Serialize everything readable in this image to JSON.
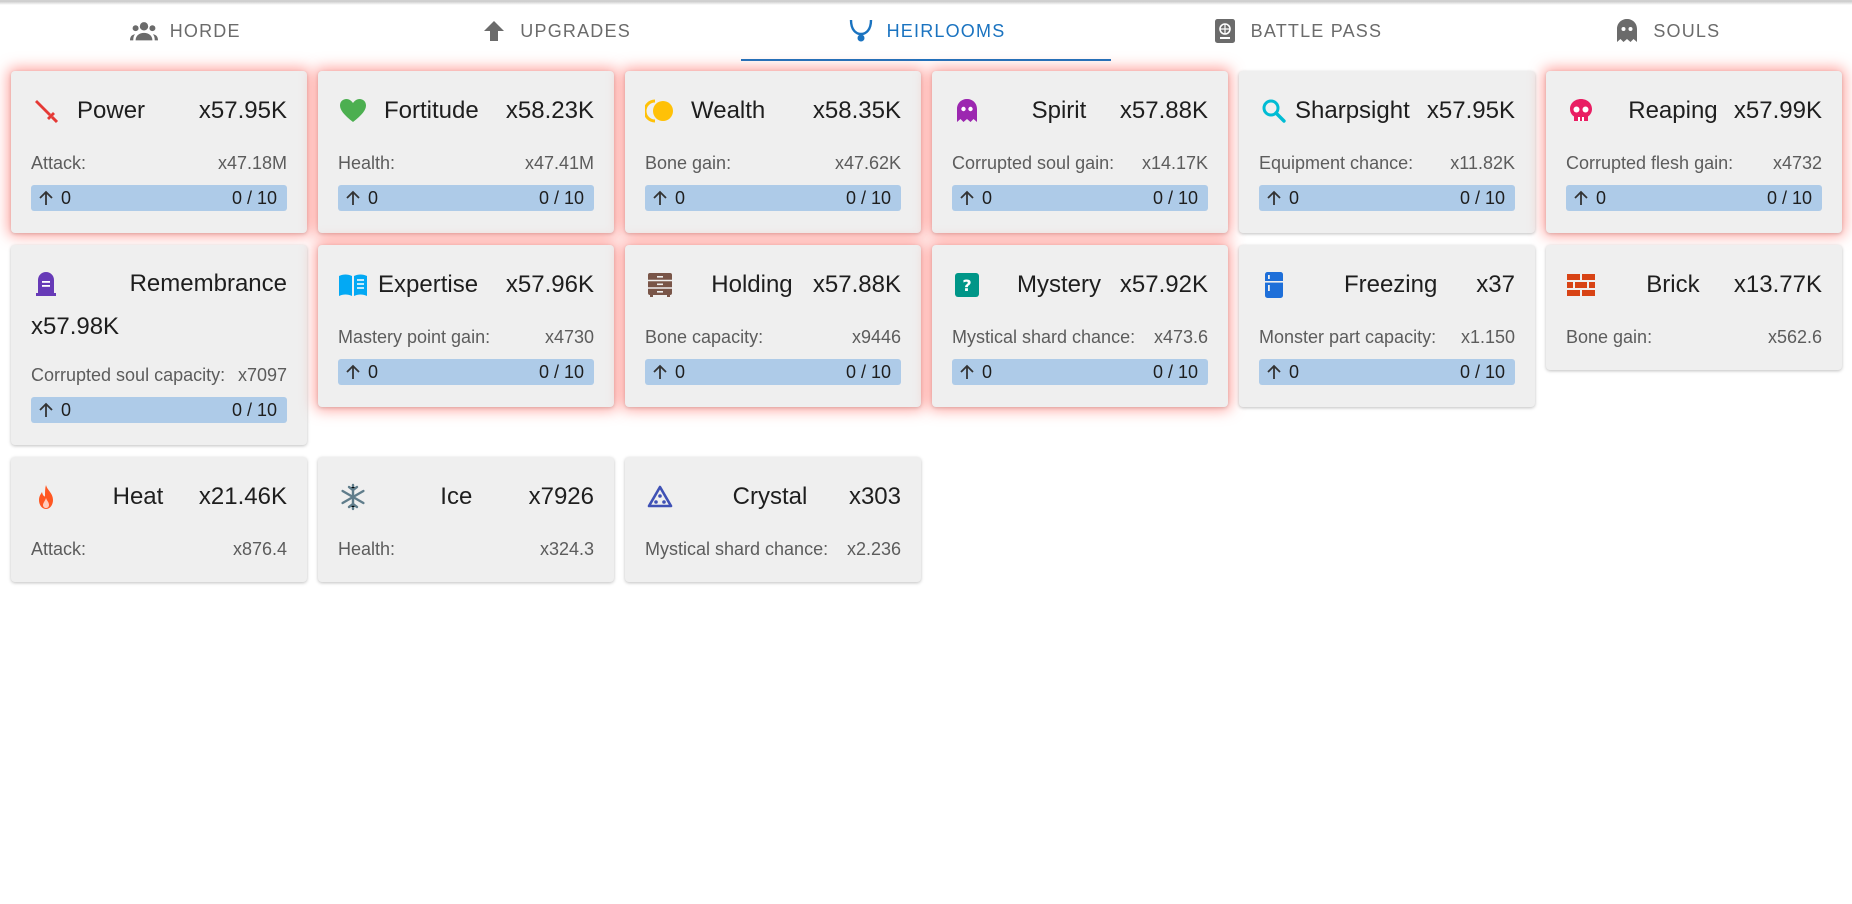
{
  "tabs": [
    {
      "label": "HORDE",
      "icon": "group-icon"
    },
    {
      "label": "UPGRADES",
      "icon": "arrow-up-icon"
    },
    {
      "label": "HEIRLOOMS",
      "icon": "necklace-icon",
      "active": true
    },
    {
      "label": "BATTLE PASS",
      "icon": "passport-icon"
    },
    {
      "label": "SOULS",
      "icon": "ghost-icon"
    }
  ],
  "colors": {
    "accent": "#1a73c0",
    "bar": "#aecbe8",
    "glow": "#ff5a50"
  },
  "heirlooms": [
    {
      "name": "Power",
      "mult": "x57.95K",
      "effect_label": "Attack:",
      "effect_value": "x47.18M",
      "level": "0",
      "count": "0 / 10",
      "icon": "sword-icon",
      "icon_color": "#e53935"
    },
    {
      "name": "Fortitude",
      "mult": "x58.23K",
      "effect_label": "Health:",
      "effect_value": "x47.41M",
      "level": "0",
      "count": "0 / 10",
      "icon": "heart-icon",
      "icon_color": "#4caf50"
    },
    {
      "name": "Wealth",
      "mult": "x58.35K",
      "effect_label": "Bone gain:",
      "effect_value": "x47.62K",
      "level": "0",
      "count": "0 / 10",
      "icon": "coins-icon",
      "icon_color": "#ffc107"
    },
    {
      "name": "Spirit",
      "mult": "x57.88K",
      "effect_label": "Corrupted soul gain:",
      "effect_value": "x14.17K",
      "level": "0",
      "count": "0 / 10",
      "icon": "ghost-icon",
      "icon_color": "#9c27b0"
    },
    {
      "name": "Sharpsight",
      "mult": "x57.95K",
      "effect_label": "Equipment chance:",
      "effect_value": "x11.82K",
      "level": "0",
      "count": "0 / 10",
      "icon": "magnifier-icon",
      "icon_color": "#00bcd4"
    },
    {
      "name": "Reaping",
      "mult": "x57.99K",
      "effect_label": "Corrupted flesh gain:",
      "effect_value": "x4732",
      "level": "0",
      "count": "0 / 10",
      "icon": "skull-icon",
      "icon_color": "#e91e63"
    },
    {
      "name": "Remembrance",
      "mult": "x57.98K",
      "effect_label": "Corrupted soul capacity:",
      "effect_value": "x7097",
      "level": "0",
      "count": "0 / 10",
      "icon": "gravestone-icon",
      "icon_color": "#673ab7"
    },
    {
      "name": "Expertise",
      "mult": "x57.96K",
      "effect_label": "Mastery point gain:",
      "effect_value": "x4730",
      "level": "0",
      "count": "0 / 10",
      "icon": "book-icon",
      "icon_color": "#03a9f4"
    },
    {
      "name": "Holding",
      "mult": "x57.88K",
      "effect_label": "Bone capacity:",
      "effect_value": "x9446",
      "level": "0",
      "count": "0 / 10",
      "icon": "dresser-icon",
      "icon_color": "#795548"
    },
    {
      "name": "Mystery",
      "mult": "x57.92K",
      "effect_label": "Mystical shard chance:",
      "effect_value": "x473.6",
      "level": "0",
      "count": "0 / 10",
      "icon": "question-box-icon",
      "icon_color": "#009688"
    },
    {
      "name": "Freezing",
      "mult": "x37",
      "effect_label": "Monster part capacity:",
      "effect_value": "x1.150",
      "level": "0",
      "count": "0 / 10",
      "icon": "fridge-icon",
      "icon_color": "#1e6fd9"
    },
    {
      "name": "Brick",
      "mult": "x13.77K",
      "effect_label": "Bone gain:",
      "effect_value": "x562.6",
      "icon": "brick-wall-icon",
      "icon_color": "#d84315"
    },
    {
      "name": "Heat",
      "mult": "x21.46K",
      "effect_label": "Attack:",
      "effect_value": "x876.4",
      "icon": "fire-icon",
      "icon_color": "#ff5722"
    },
    {
      "name": "Ice",
      "mult": "x7926",
      "effect_label": "Health:",
      "effect_value": "x324.3",
      "icon": "snowflake-icon",
      "icon_color": "#607d8b"
    },
    {
      "name": "Crystal",
      "mult": "x303",
      "effect_label": "Mystical shard chance:",
      "effect_value": "x2.236",
      "icon": "crystal-icon",
      "icon_color": "#3f51b5"
    }
  ]
}
